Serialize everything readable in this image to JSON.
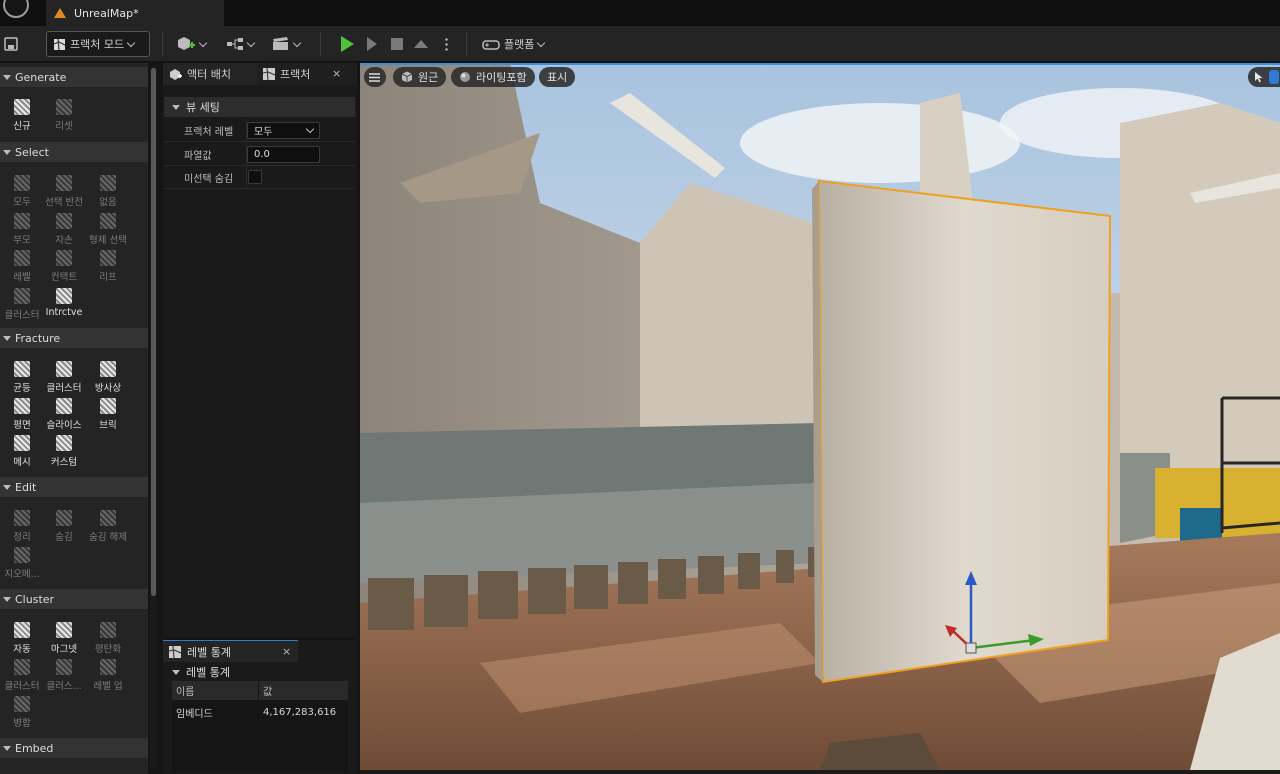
{
  "window": {
    "doc_tab": "UnrealMap*"
  },
  "toolbar": {
    "mode_label": "프랙처 모드",
    "platforms_label": "플랫폼"
  },
  "palette": {
    "generate": {
      "title": "Generate",
      "tools": [
        "신규",
        "리셋"
      ]
    },
    "select": {
      "title": "Select",
      "tools": [
        "모두",
        "선택 반전",
        "없음",
        "부모",
        "자손",
        "형제 선택",
        "레벨",
        "컨택트",
        "리프",
        "클러스터",
        "Intrctve"
      ]
    },
    "fracture": {
      "title": "Fracture",
      "tools": [
        "균등",
        "클러스터",
        "방사상",
        "평면",
        "슬라이스",
        "브릭",
        "메시",
        "커스텀"
      ]
    },
    "edit": {
      "title": "Edit",
      "tools": [
        "정리",
        "숨김",
        "숨김 해제",
        "지오메..."
      ]
    },
    "cluster": {
      "title": "Cluster",
      "tools": [
        "자동",
        "마그넷",
        "평탄화",
        "클러스터",
        "클러스...",
        "레벨 업",
        "병합"
      ]
    },
    "embed": {
      "title": "Embed"
    }
  },
  "details": {
    "tab_actor": "액터 배치",
    "tab_fracture": "프랙처",
    "close": "×",
    "section": "뷰 세팅",
    "props": {
      "level_label": "프랙처 레벨",
      "level_value": "모두",
      "explode_label": "파열값",
      "explode_value": "0.0",
      "hide_label": "미선택 숨김",
      "hide_checked": false
    }
  },
  "stats": {
    "tab": "레벨 통계",
    "close": "×",
    "section": "레벨 통계",
    "col_name": "이름",
    "col_value": "값",
    "row_name": "임베디드",
    "row_value": "4,167,283,616"
  },
  "viewport": {
    "perspective": "원근",
    "lighting": "라이팅포함",
    "show": "표시"
  },
  "colors": {
    "accent": "#2d7bd6",
    "selection": "#f0a020",
    "play": "#4fc23a"
  }
}
